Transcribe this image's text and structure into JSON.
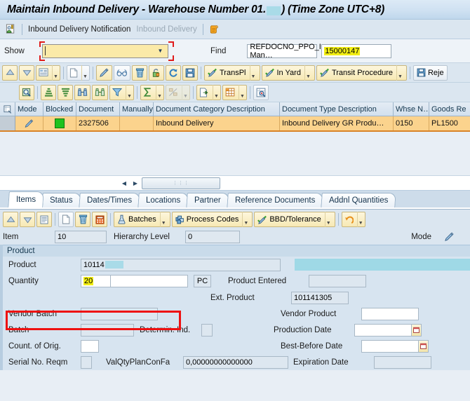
{
  "window": {
    "title_before": "Maintain Inbound Delivery - Warehouse Number 01.",
    "title_after": ") (Time Zone UTC+8)"
  },
  "linkbar": {
    "icon": "document-person-icon",
    "links": [
      {
        "label": "Inbound Delivery Notification",
        "state": "enabled"
      },
      {
        "label": "Inbound Delivery",
        "state": "disabled"
      }
    ],
    "scroll_icon": "scroll-document-icon"
  },
  "findbar": {
    "show_label": "Show",
    "show_value": "",
    "show_placeholder": "",
    "find_label": "Find",
    "find_field_value": "REFDOCNO_PPO_I Man…",
    "find_value": "15000147",
    "dropdown_icon": "chevron-down-icon"
  },
  "toolbar_top": [
    {
      "name": "move-up-button",
      "icon": "arrow-up-icon",
      "label": "",
      "split": false
    },
    {
      "name": "move-down-button",
      "icon": "arrow-down-icon",
      "label": "",
      "split": false
    },
    {
      "name": "display-list-button",
      "icon": "list-detail-icon",
      "label": "",
      "split": true
    },
    {
      "name": "create-button",
      "icon": "new-document-icon",
      "label": "",
      "split": true
    },
    {
      "name": "edit-button",
      "icon": "pencil-icon",
      "label": "",
      "split": false
    },
    {
      "name": "display-glasses-button",
      "icon": "glasses-icon",
      "label": "",
      "split": false
    },
    {
      "name": "delete-button",
      "icon": "trash-icon",
      "label": "",
      "split": false
    },
    {
      "name": "unlock-button",
      "icon": "unlock-icon",
      "label": "",
      "split": false
    },
    {
      "name": "refresh-button",
      "icon": "refresh-icon",
      "label": "",
      "split": false
    },
    {
      "name": "save-button",
      "icon": "save-disk-icon",
      "label": "",
      "split": false
    },
    {
      "name": "transport-plan-button",
      "icon": "check-pencil-icon",
      "label": "TransPl",
      "split": true
    },
    {
      "name": "in-yard-button",
      "icon": "check-pencil-icon",
      "label": "In Yard",
      "split": true
    },
    {
      "name": "transit-procedure-button",
      "icon": "check-pencil-icon",
      "label": "Transit Procedure",
      "split": true
    },
    {
      "name": "reject-button",
      "icon": "save-disk-icon",
      "label": "Reje",
      "split": false
    }
  ],
  "toolbar_second": [
    {
      "name": "find-document-button",
      "icon": "magnifier-doc-icon",
      "label": "",
      "split": false
    },
    {
      "name": "sort-ascending-button",
      "icon": "sort-ascending-icon",
      "label": "",
      "split": false
    },
    {
      "name": "sort-descending-button",
      "icon": "sort-descending-icon",
      "label": "",
      "split": false
    },
    {
      "name": "find-button",
      "icon": "binoculars-icon",
      "label": "",
      "split": false
    },
    {
      "name": "find-next-button",
      "icon": "binoculars-plus-icon",
      "label": "",
      "split": false
    },
    {
      "name": "filter-button",
      "icon": "funnel-icon",
      "label": "",
      "split": true
    },
    {
      "name": "total-button",
      "icon": "sigma-icon",
      "label": "",
      "split": true
    },
    {
      "name": "subtotal-button",
      "icon": "subtotal-icon",
      "label": "",
      "split": true,
      "disabled": true
    },
    {
      "name": "export-button",
      "icon": "export-icon",
      "label": "",
      "split": true
    },
    {
      "name": "layout-button",
      "icon": "table-layout-icon",
      "label": "",
      "split": true
    },
    {
      "name": "detail-button",
      "icon": "magnifier-table-icon",
      "label": "",
      "split": false
    }
  ],
  "grid": {
    "select_all_icon": "select-all-icon",
    "columns": [
      {
        "label": "Mode",
        "width": 40
      },
      {
        "label": "Blocked",
        "width": 47
      },
      {
        "label": "Document",
        "width": 62
      },
      {
        "label": "Manually",
        "width": 48
      },
      {
        "label": "Document Category Description",
        "width": 180
      },
      {
        "label": "Document Type Description",
        "width": 162
      },
      {
        "label": "Whse N…",
        "width": 51
      },
      {
        "label": "Goods Re",
        "width": 58
      }
    ],
    "rows": [
      {
        "mode_icon": "pencil-icon",
        "blocked": "green-status-box",
        "document": "2327506",
        "manually": "",
        "doc_category_description": "Inbound Delivery",
        "doc_type_description": "Inbound Delivery GR Produ…",
        "whse_no": "0150",
        "goods_re": "PL1500"
      }
    ]
  },
  "hscroll": {
    "left_icon": "scroll-left-icon",
    "right_icon": "scroll-right-icon",
    "grip": "⋮⋮⋮"
  },
  "tabs": [
    {
      "label": "Items",
      "active": true
    },
    {
      "label": "Status",
      "active": false
    },
    {
      "label": "Dates/Times",
      "active": false
    },
    {
      "label": "Locations",
      "active": false
    },
    {
      "label": "Partner",
      "active": false
    },
    {
      "label": "Reference Documents",
      "active": false
    },
    {
      "label": "Addnl Quantities",
      "active": false
    }
  ],
  "item_toolbar": [
    {
      "name": "item-up-button",
      "icon": "arrow-up-icon",
      "label": "",
      "split": false
    },
    {
      "name": "item-down-button",
      "icon": "arrow-down-icon",
      "label": "",
      "split": false
    },
    {
      "name": "item-list-button",
      "icon": "list-lines-icon",
      "label": "",
      "split": false
    },
    {
      "name": "item-create-button",
      "icon": "new-document-icon",
      "label": "",
      "split": false
    },
    {
      "name": "item-delete-button",
      "icon": "trash-icon",
      "label": "",
      "split": false
    },
    {
      "name": "item-calculator-button",
      "icon": "calculator-icon",
      "label": "",
      "split": false
    },
    {
      "name": "batches-button",
      "icon": "flask-icon",
      "label": "Batches",
      "split": true
    },
    {
      "name": "process-codes-button",
      "icon": "stacked-boxes-icon",
      "label": "Process Codes",
      "split": true
    },
    {
      "name": "bbd-tolerance-button",
      "icon": "check-pencil-icon",
      "label": "BBD/Tolerance",
      "split": true
    },
    {
      "name": "undo-button",
      "icon": "undo-arrow-icon",
      "label": "",
      "split": true
    }
  ],
  "item_fields": {
    "item_label": "Item",
    "item_value": "10",
    "hierarchy_label": "Hierarchy Level",
    "hierarchy_value": "0",
    "mode_label": "Mode",
    "mode_icon": "pencil-icon"
  },
  "product_panel": {
    "group_title": "Product",
    "left": {
      "product_label": "Product",
      "product_value": "10114",
      "quantity_label": "Quantity",
      "quantity_value": "20",
      "quantity_value2": "",
      "unit_value": "PC",
      "vendor_batch_label": "Vendor Batch",
      "vendor_batch_value": "",
      "batch_label": "Batch",
      "batch_value": "",
      "determin_label": "Determin. Ind.",
      "determin_value": "",
      "count_orig_label": "Count. of Orig.",
      "count_orig_value": "",
      "serial_label": "Serial No. Reqm",
      "serial_value": "",
      "valqty_label": "ValQtyPlanConFa",
      "valqty_value": "0,00000000000000"
    },
    "right": {
      "product_entered_label": "Product Entered",
      "product_entered_value": "",
      "ext_product_label": "Ext. Product",
      "ext_product_value": "101141305",
      "vendor_product_label": "Vendor Product",
      "vendor_product_value": "",
      "production_date_label": "Production Date",
      "production_date_value": "",
      "best_before_label": "Best-Before Date",
      "best_before_value": "",
      "expiration_label": "Expiration Date",
      "expiration_value": ""
    }
  },
  "colors": {
    "accent_yellow_button": "#f7e9b4",
    "highlight_yellow": "#f2ee13",
    "annotation_red": "#ee1111",
    "row_orange": "#fbd38d",
    "status_green": "#1fc21f",
    "redaction_cyan": "#a9dbe8",
    "panel_blue": "#d7e4f0"
  }
}
